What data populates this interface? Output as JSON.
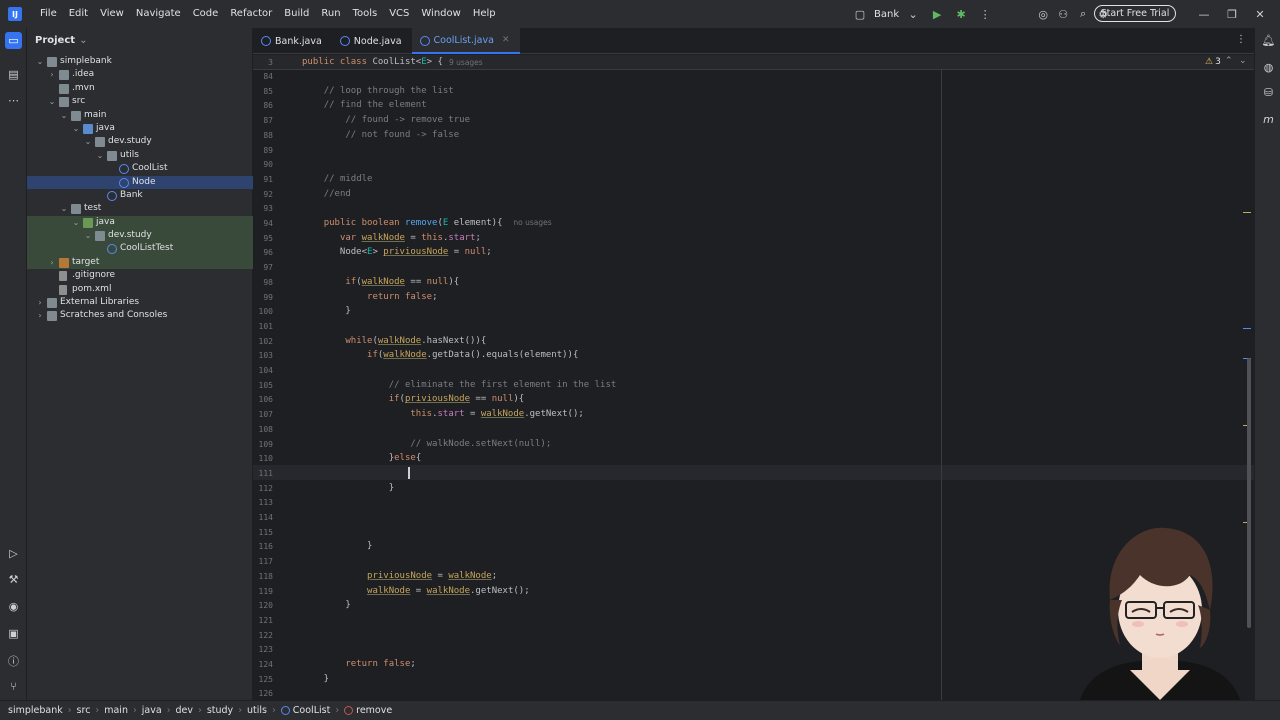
{
  "menu": [
    "File",
    "Edit",
    "View",
    "Navigate",
    "Code",
    "Refactor",
    "Build",
    "Run",
    "Tools",
    "VCS",
    "Window",
    "Help"
  ],
  "run_config": "Bank",
  "trial_button": "Start Free Trial",
  "project_panel": {
    "title": "Project",
    "tree": [
      {
        "label": "simplebank",
        "depth": 0,
        "chev": "v",
        "icon": "folder"
      },
      {
        "label": ".idea",
        "depth": 1,
        "chev": ">",
        "icon": "folder"
      },
      {
        "label": ".mvn",
        "depth": 1,
        "chev": "",
        "icon": "folder"
      },
      {
        "label": "src",
        "depth": 1,
        "chev": "v",
        "icon": "folder"
      },
      {
        "label": "main",
        "depth": 2,
        "chev": "v",
        "icon": "folder"
      },
      {
        "label": "java",
        "depth": 3,
        "chev": "v",
        "icon": "folder-blue"
      },
      {
        "label": "dev.study",
        "depth": 4,
        "chev": "v",
        "icon": "folder"
      },
      {
        "label": "utils",
        "depth": 5,
        "chev": "v",
        "icon": "folder"
      },
      {
        "label": "CoolList",
        "depth": 6,
        "chev": "",
        "icon": "class"
      },
      {
        "label": "Node",
        "depth": 6,
        "chev": "",
        "icon": "class",
        "selected": true
      },
      {
        "label": "Bank",
        "depth": 5,
        "chev": "",
        "icon": "class"
      },
      {
        "label": "test",
        "depth": 2,
        "chev": "v",
        "icon": "folder"
      },
      {
        "label": "java",
        "depth": 3,
        "chev": "v",
        "icon": "folder-green",
        "testhl": true
      },
      {
        "label": "dev.study",
        "depth": 4,
        "chev": "v",
        "icon": "folder",
        "testhl": true
      },
      {
        "label": "CoolListTest",
        "depth": 5,
        "chev": "",
        "icon": "class",
        "testhl": true
      },
      {
        "label": "target",
        "depth": 1,
        "chev": ">",
        "icon": "folder-orange",
        "testhl": true
      },
      {
        "label": ".gitignore",
        "depth": 1,
        "chev": "",
        "icon": "file"
      },
      {
        "label": "pom.xml",
        "depth": 1,
        "chev": "",
        "icon": "file"
      },
      {
        "label": "External Libraries",
        "depth": 0,
        "chev": ">",
        "icon": "folder"
      },
      {
        "label": "Scratches and Consoles",
        "depth": 0,
        "chev": ">",
        "icon": "folder"
      }
    ]
  },
  "tabs": [
    {
      "label": "Bank.java",
      "active": false
    },
    {
      "label": "Node.java",
      "active": false
    },
    {
      "label": "CoolList.java",
      "active": true
    }
  ],
  "sticky": {
    "line_no": "3",
    "code": "public class CoolList<E> {",
    "hint": "9 usages"
  },
  "warnings_count": "3",
  "editor_lines": [
    {
      "n": "84",
      "html": ""
    },
    {
      "n": "85",
      "html": "    <span class='cm'>// loop through the list</span>"
    },
    {
      "n": "86",
      "html": "    <span class='cm'>// find the element</span>"
    },
    {
      "n": "87",
      "html": "        <span class='cm'>// found -> remove true</span>"
    },
    {
      "n": "88",
      "html": "        <span class='cm'>// not found -> false</span>"
    },
    {
      "n": "89",
      "html": ""
    },
    {
      "n": "90",
      "html": ""
    },
    {
      "n": "91",
      "html": "    <span class='cm'>// middle</span>"
    },
    {
      "n": "92",
      "html": "    <span class='cm'>//end</span>"
    },
    {
      "n": "93",
      "html": ""
    },
    {
      "n": "94",
      "html": "    <span class='kw'>public boolean</span> <span class='fn'>remove</span>(<span class='tp'>E</span> element){  <span class='hint'>no usages</span>"
    },
    {
      "n": "95",
      "html": "       <span class='kw'>var</span> <span class='lv'>walkNode</span> = <span class='kw'>this</span>.<span class='var'>start</span>;"
    },
    {
      "n": "96",
      "html": "       Node&lt;<span class='tp'>E</span>&gt; <span class='lv'>priviousNode</span> = <span class='kw'>null</span>;"
    },
    {
      "n": "97",
      "html": ""
    },
    {
      "n": "98",
      "html": "        <span class='kw'>if</span>(<span class='lv'>walkNode</span> == <span class='kw'>null</span>){"
    },
    {
      "n": "99",
      "html": "            <span class='kw'>return false</span>;"
    },
    {
      "n": "100",
      "html": "        }"
    },
    {
      "n": "101",
      "html": ""
    },
    {
      "n": "102",
      "html": "        <span class='kw'>while</span>(<span class='lv'>walkNode</span>.hasNext()){"
    },
    {
      "n": "103",
      "html": "            <span class='kw'>if</span>(<span class='lv'>walkNode</span>.getData().equals(element)){"
    },
    {
      "n": "104",
      "html": ""
    },
    {
      "n": "105",
      "html": "                <span class='cm'>// eliminate the first element in the list</span>"
    },
    {
      "n": "106",
      "html": "                <span class='kw'>if</span>(<span class='lv'>priviousNode</span> == <span class='kw'>null</span>){"
    },
    {
      "n": "107",
      "html": "                    <span class='kw'>this</span>.<span class='var'>start</span> = <span class='lv'>walkNode</span>.getNext();"
    },
    {
      "n": "108",
      "html": ""
    },
    {
      "n": "109",
      "html": "                    <span class='cm'>// walkNode.setNext(null);</span>"
    },
    {
      "n": "110",
      "html": "                }<span class='kw'>else</span>{"
    },
    {
      "n": "111",
      "html": ""
    },
    {
      "n": "112",
      "html": "                }"
    },
    {
      "n": "113",
      "html": ""
    },
    {
      "n": "114",
      "html": ""
    },
    {
      "n": "115",
      "html": ""
    },
    {
      "n": "116",
      "html": "            }"
    },
    {
      "n": "117",
      "html": ""
    },
    {
      "n": "118",
      "html": "            <span class='lv'>priviousNode</span> = <span class='lv'>walkNode</span>;"
    },
    {
      "n": "119",
      "html": "            <span class='lv'>walkNode</span> = <span class='lv'>walkNode</span>.getNext();"
    },
    {
      "n": "120",
      "html": "        }"
    },
    {
      "n": "121",
      "html": ""
    },
    {
      "n": "122",
      "html": ""
    },
    {
      "n": "123",
      "html": ""
    },
    {
      "n": "124",
      "html": "        <span class='kw'>return false</span>;"
    },
    {
      "n": "125",
      "html": "    }"
    },
    {
      "n": "126",
      "html": ""
    }
  ],
  "breadcrumbs": [
    "simplebank",
    "src",
    "main",
    "java",
    "dev",
    "study",
    "utils",
    "CoolList",
    "remove"
  ]
}
